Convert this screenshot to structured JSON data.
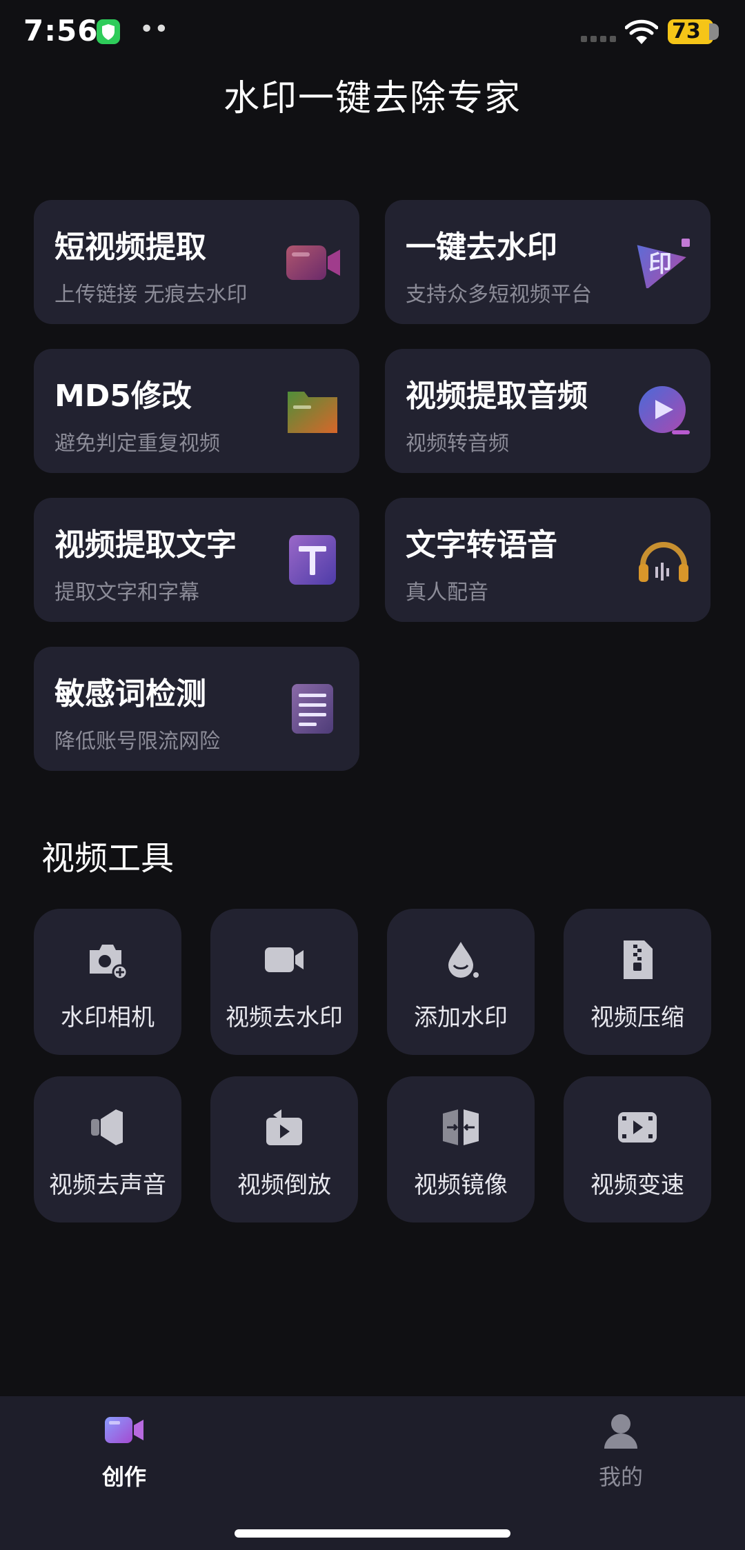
{
  "status_bar": {
    "time": "7:56",
    "battery": "73"
  },
  "app": {
    "title": "水印一键去除专家"
  },
  "features": [
    {
      "title": "短视频提取",
      "subtitle": "上传链接 无痕去水印",
      "icon": "video-camera-icon"
    },
    {
      "title": "一键去水印",
      "subtitle": "支持众多短视频平台",
      "icon": "stamp-play-icon",
      "icon_text": "印"
    },
    {
      "title": "MD5修改",
      "subtitle": "避免判定重复视频",
      "icon": "folder-icon"
    },
    {
      "title": "视频提取音频",
      "subtitle": "视频转音频",
      "icon": "play-circle-icon"
    },
    {
      "title": "视频提取文字",
      "subtitle": "提取文字和字幕",
      "icon": "text-t-icon"
    },
    {
      "title": "文字转语音",
      "subtitle": "真人配音",
      "icon": "headphones-icon"
    },
    {
      "title": "敏感词检测",
      "subtitle": "降低账号限流网险",
      "icon": "document-lines-icon"
    }
  ],
  "tools_section": {
    "title": "视频工具",
    "tools": [
      {
        "label": "水印相机",
        "icon": "camera-plus-icon"
      },
      {
        "label": "视频去水印",
        "icon": "video-camera-icon"
      },
      {
        "label": "添加水印",
        "icon": "water-drop-icon"
      },
      {
        "label": "视频压缩",
        "icon": "zip-file-icon"
      },
      {
        "label": "视频去声音",
        "icon": "speaker-mute-icon"
      },
      {
        "label": "视频倒放",
        "icon": "replay-icon"
      },
      {
        "label": "视频镜像",
        "icon": "mirror-icon"
      },
      {
        "label": "视频变速",
        "icon": "film-play-icon"
      }
    ]
  },
  "bottom_nav": {
    "items": [
      {
        "label": "创作",
        "icon": "video-camera-icon",
        "active": true
      },
      {
        "label": "我的",
        "icon": "user-icon",
        "active": false
      }
    ]
  },
  "colors": {
    "background": "#101013",
    "card": "#222230",
    "nav": "#1e1e2a",
    "muted_text": "#8c8c98",
    "battery": "#f5c518",
    "shield": "#2ecc5a"
  }
}
